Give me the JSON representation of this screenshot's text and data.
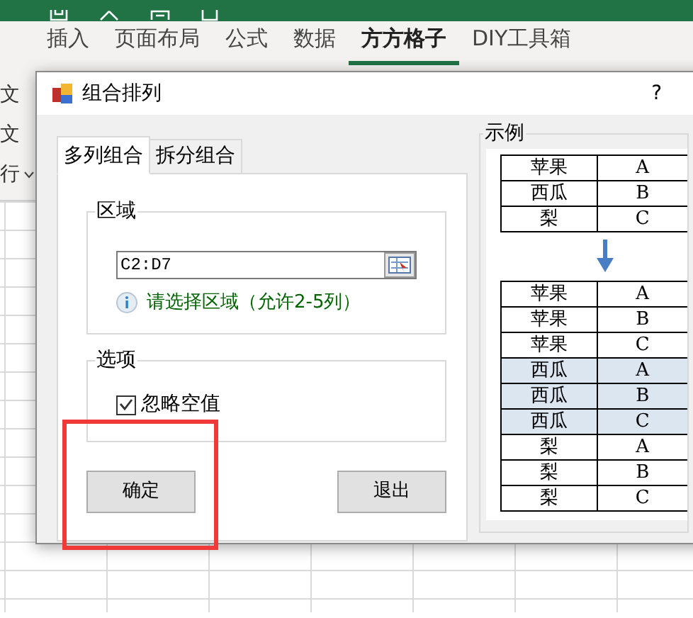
{
  "ribbon": {
    "tabs": [
      {
        "label": "插入",
        "selected": false
      },
      {
        "label": "页面布局",
        "selected": false
      },
      {
        "label": "公式",
        "selected": false
      },
      {
        "label": "数据",
        "selected": false
      },
      {
        "label": "方方格子",
        "selected": true
      },
      {
        "label": "DIY工具箱",
        "selected": false
      }
    ],
    "side_labels": [
      "文",
      "文",
      "行"
    ]
  },
  "dialog": {
    "title": "组合排列",
    "help": "?",
    "tabs": [
      {
        "label": "多列组合",
        "selected": true
      },
      {
        "label": "拆分组合",
        "selected": false
      }
    ],
    "range_group": {
      "legend": "区域",
      "value": "C2:D7",
      "hint": "请选择区域（允许2-5列）"
    },
    "options_group": {
      "legend": "选项",
      "options": [
        {
          "label": "忽略空值",
          "checked": true
        }
      ]
    },
    "buttons": [
      {
        "label": "确定",
        "highlighted": true
      },
      {
        "label": "退出",
        "highlighted": false
      }
    ],
    "example": {
      "legend": "示例",
      "source_rows": [
        {
          "cells": [
            "苹果",
            "A"
          ],
          "highlighted": false
        },
        {
          "cells": [
            "西瓜",
            "B"
          ],
          "highlighted": false
        },
        {
          "cells": [
            "梨",
            "C"
          ],
          "highlighted": false
        }
      ],
      "result_rows": [
        {
          "cells": [
            "苹果",
            "A"
          ],
          "highlighted": false
        },
        {
          "cells": [
            "苹果",
            "B"
          ],
          "highlighted": false
        },
        {
          "cells": [
            "苹果",
            "C"
          ],
          "highlighted": false
        },
        {
          "cells": [
            "西瓜",
            "A"
          ],
          "highlighted": true
        },
        {
          "cells": [
            "西瓜",
            "B"
          ],
          "highlighted": true
        },
        {
          "cells": [
            "西瓜",
            "C"
          ],
          "highlighted": true
        },
        {
          "cells": [
            "梨",
            "A"
          ],
          "highlighted": false
        },
        {
          "cells": [
            "梨",
            "B"
          ],
          "highlighted": false
        },
        {
          "cells": [
            "梨",
            "C"
          ],
          "highlighted": false
        }
      ]
    }
  }
}
